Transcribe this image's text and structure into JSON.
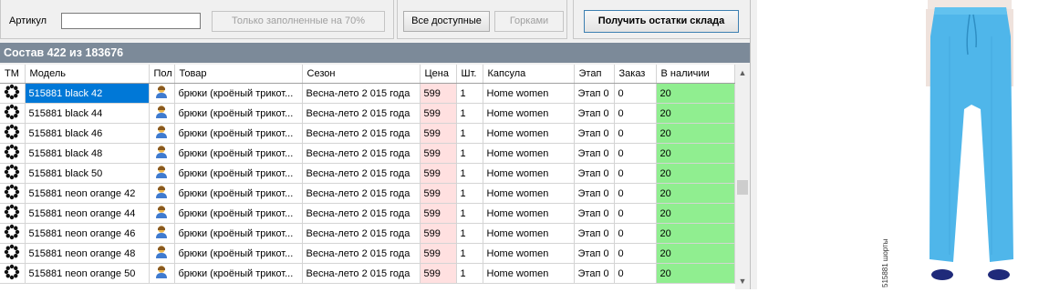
{
  "filter": {
    "artikul_label": "Артикул",
    "artikul_value": "",
    "fill70_button": "Только заполненные на 70%",
    "all_available_button": "Все доступные",
    "gorkami_button": "Горками",
    "get_stock_button": "Получить остатки склада"
  },
  "composition": {
    "header": "Состав 422 из 183676"
  },
  "columns": {
    "tm": "ТМ",
    "model": "Модель",
    "pol": "Пол",
    "tovar": "Товар",
    "sezon": "Сезон",
    "cena": "Цена",
    "sht": "Шт.",
    "kapsula": "Капсула",
    "etap": "Этап",
    "zakaz": "Заказ",
    "v_nalichii": "В наличии"
  },
  "rows": [
    {
      "model": "515881 black  42",
      "tovar": "брюки (кроёный трикот...",
      "sezon": "Весна-лето 2 015 года",
      "cena": "599",
      "sht": "1",
      "kapsula": "Home women",
      "etap": "Этап 0",
      "zakaz": "0",
      "v_nalichii": "20"
    },
    {
      "model": "515881 black  44",
      "tovar": "брюки (кроёный трикот...",
      "sezon": "Весна-лето 2 015 года",
      "cena": "599",
      "sht": "1",
      "kapsula": "Home women",
      "etap": "Этап 0",
      "zakaz": "0",
      "v_nalichii": "20"
    },
    {
      "model": "515881 black  46",
      "tovar": "брюки (кроёный трикот...",
      "sezon": "Весна-лето 2 015 года",
      "cena": "599",
      "sht": "1",
      "kapsula": "Home women",
      "etap": "Этап 0",
      "zakaz": "0",
      "v_nalichii": "20"
    },
    {
      "model": "515881 black  48",
      "tovar": "брюки (кроёный трикот...",
      "sezon": "Весна-лето 2 015 года",
      "cena": "599",
      "sht": "1",
      "kapsula": "Home women",
      "etap": "Этап 0",
      "zakaz": "0",
      "v_nalichii": "20"
    },
    {
      "model": "515881 black  50",
      "tovar": "брюки (кроёный трикот...",
      "sezon": "Весна-лето 2 015 года",
      "cena": "599",
      "sht": "1",
      "kapsula": "Home women",
      "etap": "Этап 0",
      "zakaz": "0",
      "v_nalichii": "20"
    },
    {
      "model": "515881 neon orange  42",
      "tovar": "брюки (кроёный трикот...",
      "sezon": "Весна-лето 2 015 года",
      "cena": "599",
      "sht": "1",
      "kapsula": "Home women",
      "etap": "Этап 0",
      "zakaz": "0",
      "v_nalichii": "20"
    },
    {
      "model": "515881 neon orange  44",
      "tovar": "брюки (кроёный трикот...",
      "sezon": "Весна-лето 2 015 года",
      "cena": "599",
      "sht": "1",
      "kapsula": "Home women",
      "etap": "Этап 0",
      "zakaz": "0",
      "v_nalichii": "20"
    },
    {
      "model": "515881 neon orange  46",
      "tovar": "брюки (кроёный трикот...",
      "sezon": "Весна-лето 2 015 года",
      "cena": "599",
      "sht": "1",
      "kapsula": "Home women",
      "etap": "Этап 0",
      "zakaz": "0",
      "v_nalichii": "20"
    },
    {
      "model": "515881 neon orange  48",
      "tovar": "брюки (кроёный трикот...",
      "sezon": "Весна-лето 2 015 года",
      "cena": "599",
      "sht": "1",
      "kapsula": "Home women",
      "etap": "Этап 0",
      "zakaz": "0",
      "v_nalichii": "20"
    },
    {
      "model": "515881 neon orange  50",
      "tovar": "брюки (кроёный трикот...",
      "sezon": "Весна-лето 2 015 года",
      "cena": "599",
      "sht": "1",
      "kapsula": "Home women",
      "etap": "Этап 0",
      "zakaz": "0",
      "v_nalichii": "20"
    }
  ],
  "icons": {
    "tm": "brand-flower-icon",
    "pol": "female-user-icon",
    "scroll_up": "chevron-up-icon",
    "scroll_down": "chevron-down-icon"
  },
  "colors": {
    "selection": "#0078d7",
    "price_cell": "#ffe0e0",
    "stock_cell": "#90ee90",
    "header_bar": "#7c8a99",
    "product_color": "#4fb6ea"
  },
  "photo": {
    "caption": "515881 шорты"
  }
}
